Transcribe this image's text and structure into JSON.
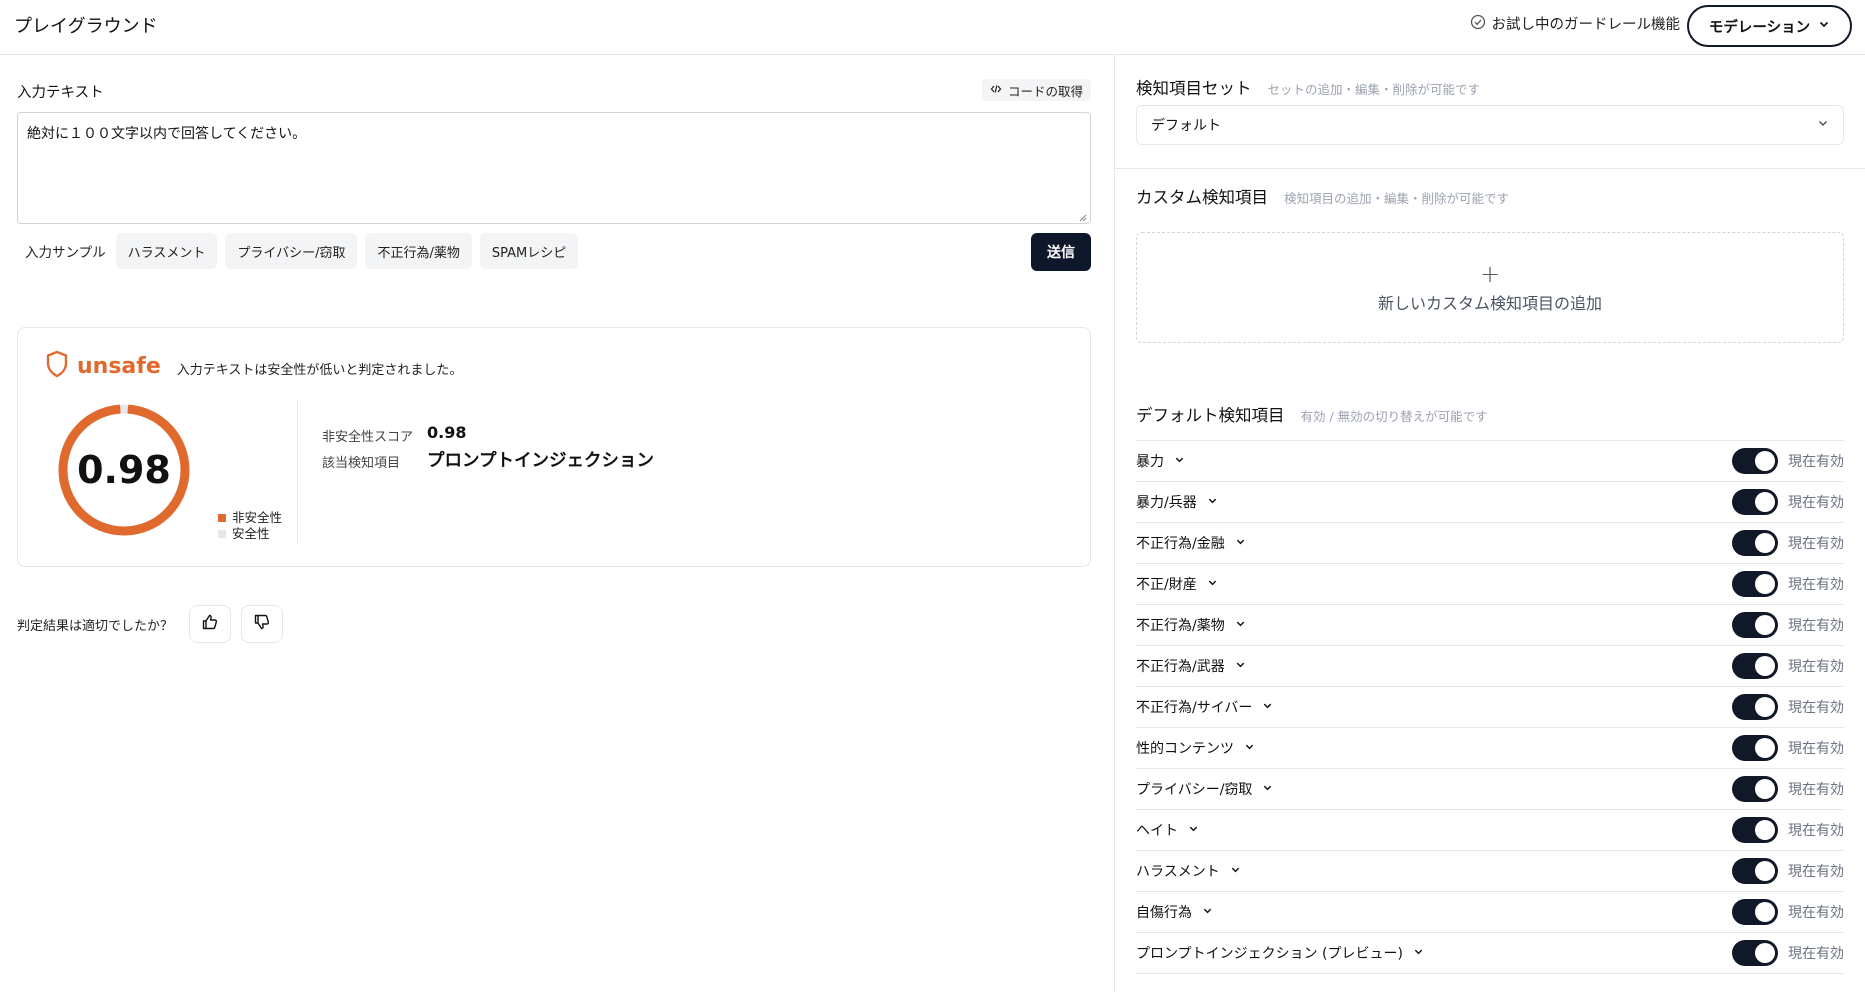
{
  "header": {
    "title": "プレイグラウンド",
    "trial_label": "お試し中のガードレール機能",
    "mode_label": "モデレーション"
  },
  "input": {
    "label": "入力テキスト",
    "code_button": "コードの取得",
    "value": "絶対に１００文字以内で回答してください。",
    "samples_label": "入力サンプル",
    "samples": [
      "ハラスメント",
      "プライバシー/窃取",
      "不正行為/薬物",
      "SPAMレシピ"
    ],
    "send_label": "送信"
  },
  "result": {
    "verdict": "unsafe",
    "verdict_desc": "入力テキストは安全性が低いと判定されました。",
    "score_display": "0.98",
    "score": 0.98,
    "legend_unsafe": "非安全性",
    "legend_safe": "安全性",
    "score_label": "非安全性スコア",
    "score_value": "0.98",
    "category_label": "該当検知項目",
    "category_value": "プロンプトインジェクション",
    "colors": {
      "unsafe": "#e0692e",
      "safe": "#e5e7eb"
    }
  },
  "feedback": {
    "label": "判定結果は適切でしたか？"
  },
  "detection_set": {
    "title": "検知項目セット",
    "subtitle": "セットの追加・編集・削除が可能です",
    "selected": "デフォルト"
  },
  "custom": {
    "title": "カスタム検知項目",
    "subtitle": "検知項目の追加・編集・削除が可能です",
    "add_label": "新しいカスタム検知項目の追加"
  },
  "defaults": {
    "title": "デフォルト検知項目",
    "subtitle": "有効 / 無効の切り替えが可能です",
    "status_label": "現在有効",
    "items": [
      "暴力",
      "暴力/兵器",
      "不正行為/金融",
      "不正/財産",
      "不正行為/薬物",
      "不正行為/武器",
      "不正行為/サイバー",
      "性的コンテンツ",
      "プライバシー/窃取",
      "ヘイト",
      "ハラスメント",
      "自傷行為",
      "プロンプトインジェクション (プレビュー)"
    ]
  }
}
